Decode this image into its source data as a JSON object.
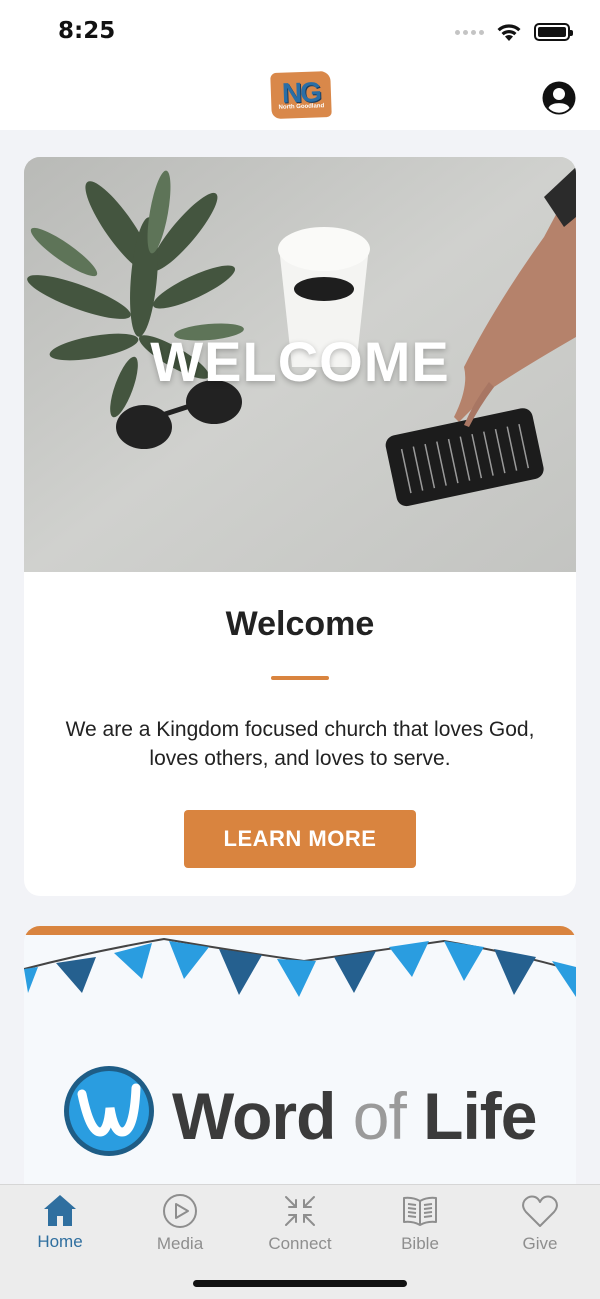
{
  "status_bar": {
    "time": "8:25"
  },
  "header": {
    "logo": {
      "letters": "NG",
      "subtitle": "North Goodland"
    }
  },
  "welcome_card": {
    "hero_text": "WELCOME",
    "title": "Welcome",
    "body": "We are a Kingdom focused church that loves God, loves others, and loves to serve.",
    "button_label": "LEARN MORE",
    "accent_color": "#d9843f"
  },
  "word_of_life_card": {
    "logo_word": "Word",
    "logo_of": "of",
    "logo_life": "Life"
  },
  "tab_bar": {
    "tabs": [
      {
        "label": "Home",
        "icon": "home-icon",
        "active": true
      },
      {
        "label": "Media",
        "icon": "play-icon",
        "active": false
      },
      {
        "label": "Connect",
        "icon": "connect-icon",
        "active": false
      },
      {
        "label": "Bible",
        "icon": "book-icon",
        "active": false
      },
      {
        "label": "Give",
        "icon": "heart-icon",
        "active": false
      }
    ],
    "active_color": "#2f6f9f"
  }
}
